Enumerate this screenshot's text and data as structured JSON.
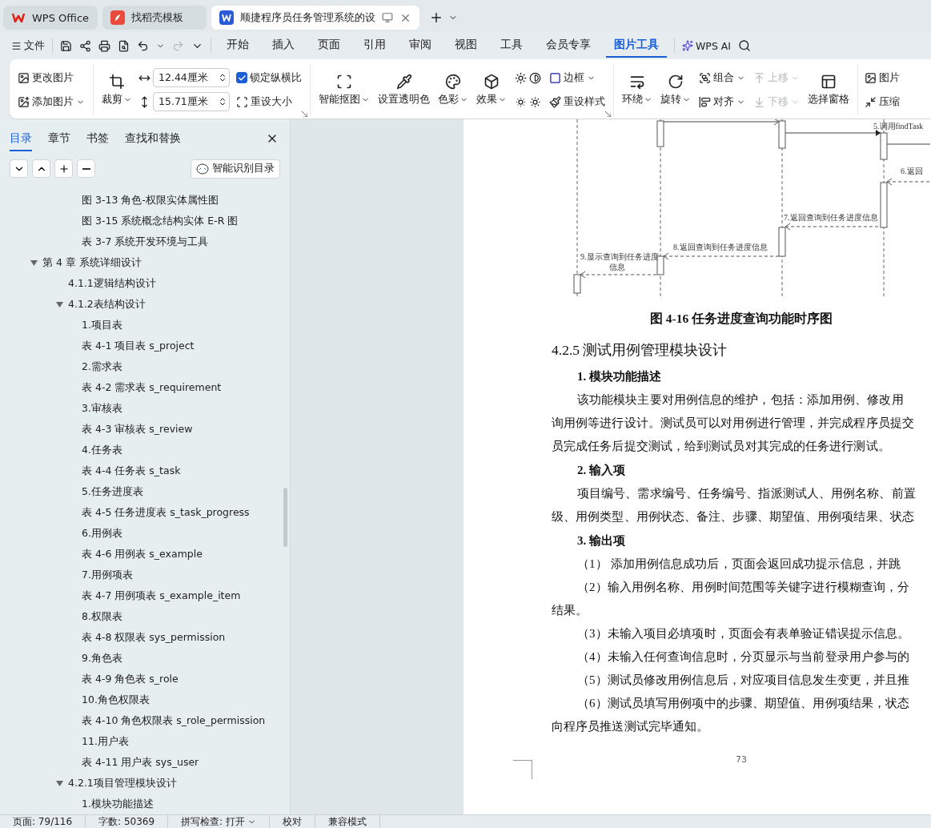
{
  "tabs": [
    {
      "label": "WPS Office",
      "kind": "home",
      "selected": false
    },
    {
      "label": "找稻壳模板",
      "kind": "template",
      "selected": false
    },
    {
      "label": "顺捷程序员任务管理系统的设",
      "kind": "document",
      "selected": true
    }
  ],
  "menu": {
    "file": "文件",
    "redo": {
      "disabled": true
    },
    "tabs": [
      {
        "label": "开始",
        "selected": false
      },
      {
        "label": "插入",
        "selected": false
      },
      {
        "label": "页面",
        "selected": false
      },
      {
        "label": "引用",
        "selected": false
      },
      {
        "label": "审阅",
        "selected": false
      },
      {
        "label": "视图",
        "selected": false
      },
      {
        "label": "工具",
        "selected": false
      },
      {
        "label": "会员专享",
        "selected": false
      },
      {
        "label": "图片工具",
        "selected": true
      }
    ],
    "ai": "WPS AI"
  },
  "ribbon": {
    "change_picture": "更改图片",
    "add_picture": "添加图片",
    "crop": "裁剪",
    "width": "12.44厘米",
    "height": "15.71厘米",
    "lock_ratio": {
      "label": "锁定纵横比",
      "checked": true
    },
    "reset_size": "重设大小",
    "smart_cutout": "智能抠图",
    "transparent": "设置透明色",
    "recolor": "色彩",
    "effect": "效果",
    "border": "边框",
    "reset_style": "重设样式",
    "wrap": "环绕",
    "rotate": "旋转",
    "group": "组合",
    "align": "对齐",
    "bring_forward": {
      "label": "上移",
      "disabled": true
    },
    "send_backward": {
      "label": "下移",
      "disabled": true
    },
    "selection_pane": "选择窗格",
    "picture": "图片",
    "compress": "压缩"
  },
  "nav": {
    "tabs": [
      {
        "label": "目录",
        "selected": true
      },
      {
        "label": "章节",
        "selected": false
      },
      {
        "label": "书签",
        "selected": false
      },
      {
        "label": "查找和替换",
        "selected": false
      }
    ],
    "smart_toc": "智能识别目录",
    "previous_items": [
      "图 3-13 角色-权限实体属性图",
      "图 3-15 系统概念结构实体 E-R 图",
      "表 3-7 系统开发环境与工具"
    ],
    "tree": [
      {
        "label": "第 4 章  系统详细设计",
        "expanded": true,
        "children": [
          {
            "label": "4.1.1逻辑结构设计"
          },
          {
            "label": "4.1.2表结构设计",
            "expanded": true,
            "children": [
              {
                "label": "1.项目表"
              },
              {
                "label": "表 4-1 项目表 s_project"
              },
              {
                "label": "2.需求表"
              },
              {
                "label": "表 4-2 需求表 s_requirement"
              },
              {
                "label": "3.审核表"
              },
              {
                "label": "表 4-3 审核表 s_review"
              },
              {
                "label": "4.任务表"
              },
              {
                "label": "表 4-4 任务表 s_task"
              },
              {
                "label": "5.任务进度表"
              },
              {
                "label": "表 4-5 任务进度表 s_task_progress"
              },
              {
                "label": "6.用例表"
              },
              {
                "label": "表 4-6 用例表 s_example"
              },
              {
                "label": "7.用例项表"
              },
              {
                "label": "表 4-7 用例项表 s_example_item"
              },
              {
                "label": "8.权限表"
              },
              {
                "label": "表 4-8 权限表 sys_permission"
              },
              {
                "label": "9.角色表"
              },
              {
                "label": "表 4-9 角色表 s_role"
              },
              {
                "label": "10.角色权限表"
              },
              {
                "label": "表 4-10 角色权限表 s_role_permission"
              },
              {
                "label": "11.用户表"
              },
              {
                "label": "表 4-11 用户表 sys_user"
              }
            ]
          },
          {
            "label": "4.2.1项目管理模块设计",
            "expanded": true,
            "children": [
              {
                "label": "1.模块功能描述"
              }
            ]
          }
        ]
      }
    ]
  },
  "document": {
    "diagram": {
      "messages": [
        "5.调用findTask",
        "6.返回",
        "7.返回查询到任务进度信息",
        "8.返回查询到任务进度信息",
        "9.显示查询到任务进度",
        "信息"
      ]
    },
    "caption": "图 4-16  任务进度查询功能时序图",
    "blocks": [
      {
        "kind": "heading",
        "text": "4.2.5  测试用例管理模块设计"
      },
      {
        "kind": "subheading",
        "text": "1.  模块功能描述"
      },
      {
        "kind": "first-line",
        "text": "该功能模块主要对用例信息的维护，包括：添加用例、修改用"
      },
      {
        "kind": "line",
        "text": "询用例等进行设计。测试员可以对用例进行管理，并完成程序员提交"
      },
      {
        "kind": "line",
        "text": "员完成任务后提交测试，给到测试员对其完成的任务进行测试。"
      },
      {
        "kind": "subheading",
        "text": "2.  输入项"
      },
      {
        "kind": "first-line",
        "text": "项目编号、需求编号、任务编号、指派测试人、用例名称、前置"
      },
      {
        "kind": "line",
        "text": "级、用例类型、用例状态、备注、步骤、期望值、用例项结果、状态"
      },
      {
        "kind": "subheading",
        "text": "3.  输出项"
      },
      {
        "kind": "first-line",
        "text": "（1）  添加用例信息成功后，页面会返回成功提示信息，并跳"
      },
      {
        "kind": "first-line",
        "text": "（2）输入用例名称、用例时间范围等关键字进行模糊查询，分"
      },
      {
        "kind": "line",
        "text": "结果。"
      },
      {
        "kind": "first-line",
        "text": "（3）未输入项目必填项时，页面会有表单验证错误提示信息。"
      },
      {
        "kind": "first-line",
        "text": "（4）未输入任何查询信息时，分页显示与当前登录用户参与的"
      },
      {
        "kind": "first-line",
        "text": "（5）测试员修改用例信息后，对应项目信息发生变更，并且推"
      },
      {
        "kind": "first-line",
        "text": "（6）测试员填写用例项中的步骤、期望值、用例项结果，状态"
      },
      {
        "kind": "line",
        "text": "向程序员推送测试完毕通知。"
      }
    ],
    "page_number": "73"
  },
  "status_bar": [
    {
      "label": "页面: 79/116",
      "dropdown": false
    },
    {
      "label": "字数: 50369",
      "dropdown": false
    },
    {
      "label": "拼写检查: 打开",
      "dropdown": true
    },
    {
      "label": "校对",
      "dropdown": false
    },
    {
      "label": "兼容模式",
      "dropdown": false
    }
  ]
}
